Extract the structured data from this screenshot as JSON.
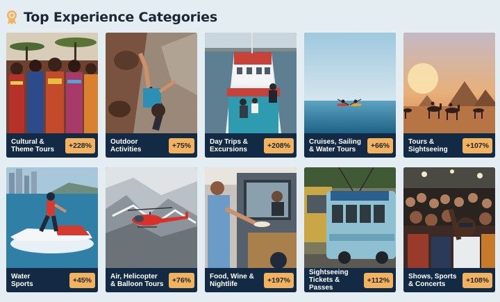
{
  "header": {
    "title": "Top Experience Categories",
    "icon": "award-ribbon-icon",
    "icon_color": "#f3b25d"
  },
  "colors": {
    "background": "#e4eef2",
    "card_caption": "#132a44",
    "badge": "#f3b25d"
  },
  "categories": [
    {
      "line1": "Cultural &",
      "line2": "Theme Tours",
      "growth": "+228%",
      "image": "tribal-dancers-photo"
    },
    {
      "line1": "Outdoor",
      "line2": "Activities",
      "growth": "+75%",
      "image": "rock-climber-photo"
    },
    {
      "line1": "Day Trips &",
      "line2": "Excursions",
      "growth": "+208%",
      "image": "boat-tour-photo"
    },
    {
      "line1": "Cruises, Sailing",
      "line2": "& Water Tours",
      "growth": "+66%",
      "image": "kayaks-sea-photo"
    },
    {
      "line1": "Tours &",
      "line2": "Sightseeing",
      "growth": "+107%",
      "image": "pyramids-camels-photo"
    },
    {
      "line1": "Water",
      "line2": "Sports",
      "growth": "+45%",
      "image": "jet-ski-photo"
    },
    {
      "line1": "Air, Helicopter",
      "line2": "& Balloon Tours",
      "growth": "+76%",
      "image": "helicopter-mountains-photo"
    },
    {
      "line1": "Food, Wine &",
      "line2": "Nightlife",
      "growth": "+197%",
      "image": "food-truck-photo"
    },
    {
      "line1": "Sightseeing",
      "line2": "Tickets & Passes",
      "growth": "+112%",
      "image": "trolley-bus-photo"
    },
    {
      "line1": "Shows, Sports",
      "line2": "& Concerts",
      "growth": "+108%",
      "image": "concert-crowd-photo"
    }
  ]
}
